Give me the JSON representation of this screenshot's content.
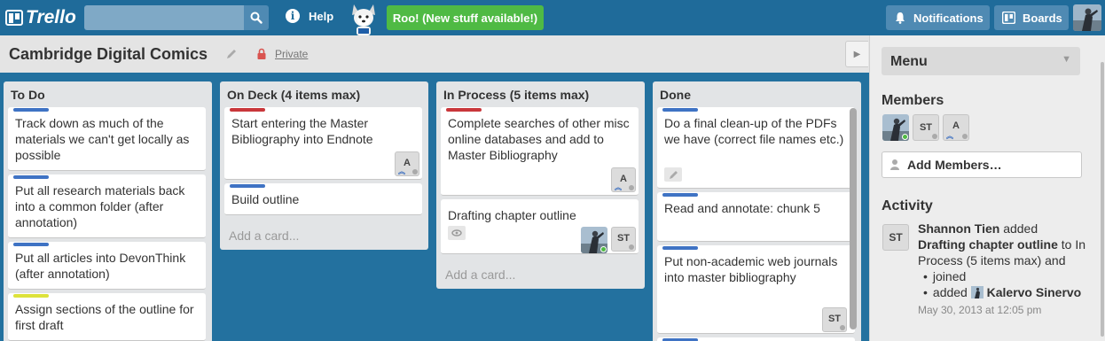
{
  "header": {
    "logo_text": "Trello",
    "search_value": "",
    "help_label": "Help",
    "roo_label": "Roo! (New stuff available!)",
    "notifications_label": "Notifications",
    "boards_label": "Boards"
  },
  "board": {
    "title": "Cambridge Digital Comics",
    "visibility": "Private"
  },
  "lists": [
    {
      "title": "To Do",
      "cards": [
        {
          "text": "Track down as much of the materials we can't get locally as possible",
          "label_color": "#3f73c4"
        },
        {
          "text": "Put all research materials back into a common folder (after annotation)",
          "label_color": "#3f73c4"
        },
        {
          "text": "Put all articles into DevonThink (after annotation)",
          "label_color": "#3f73c4"
        },
        {
          "text": "Assign sections of the outline for first draft",
          "label_color": "#dde23b"
        }
      ]
    },
    {
      "title": "On Deck (4 items max)",
      "cards": [
        {
          "text": "Start entering the Master Bibliography into Endnote",
          "label_color": "#c9373b",
          "member": "A"
        },
        {
          "text": "Build outline",
          "label_color": "#3f73c4"
        }
      ],
      "add_card": "Add a card..."
    },
    {
      "title": "In Process (5 items max)",
      "cards": [
        {
          "text": "Complete searches of other misc online databases and add to Master Bibliography",
          "label_color": "#c9373b",
          "member": "A"
        },
        {
          "text": "Drafting chapter outline",
          "member": "ST"
        }
      ],
      "add_card": "Add a card..."
    },
    {
      "title": "Done",
      "cards": [
        {
          "text": "Do a final clean-up of the PDFs we have (correct file names etc.)",
          "label_color": "#3f73c4"
        },
        {
          "text": "Read and annotate: chunk 5",
          "label_color": "#3f73c4"
        },
        {
          "text": "Put non-academic web journals into master bibliography",
          "label_color": "#3f73c4",
          "member": "ST"
        }
      ]
    }
  ],
  "sidebar": {
    "menu_label": "Menu",
    "members_heading": "Members",
    "members": [
      "ST",
      "A"
    ],
    "add_members_label": "Add Members…",
    "activity_heading": "Activity",
    "activity": {
      "avatar": "ST",
      "actor": "Shannon Tien",
      "verb": "added",
      "card": "Drafting chapter outline",
      "to_text": "to",
      "list": "In Process (5 items max) and",
      "bullet1": "joined",
      "bullet2_prefix": "added",
      "bullet2_name": "Kalervo Sinervo",
      "date": "May 30, 2013 at 12:05 pm"
    }
  },
  "icons": {
    "search": "search-icon",
    "help": "info-icon",
    "notifications": "bell-icon",
    "boards": "boards-icon",
    "edit": "pencil-icon",
    "lock": "lock-icon",
    "add_member": "person-icon"
  },
  "colors": {
    "header": "#1f6b9a",
    "board_bg": "#23719f",
    "roo": "#4fba44",
    "label_blue": "#3f73c4",
    "label_red": "#c9373b",
    "label_yellow": "#dde23b"
  }
}
